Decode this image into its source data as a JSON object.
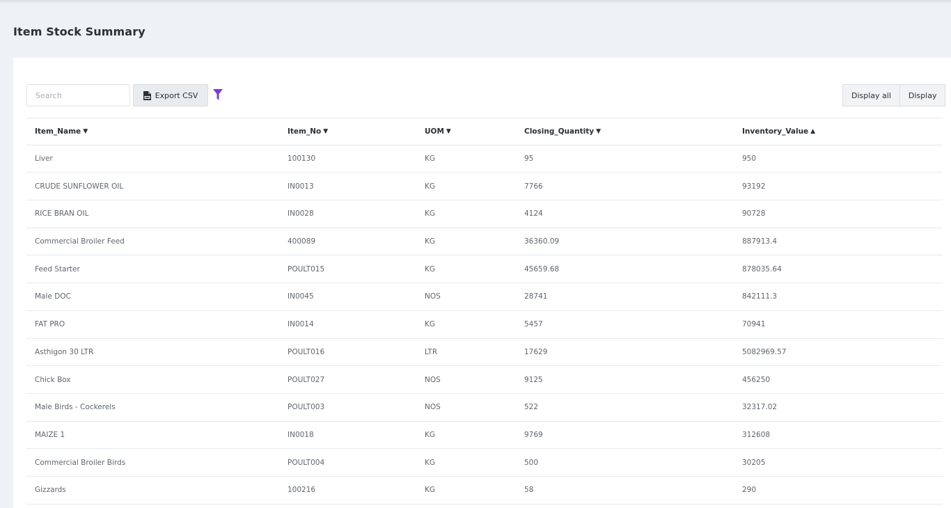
{
  "page": {
    "title": "Item Stock Summary"
  },
  "toolbar": {
    "search_placeholder": "Search",
    "export_label": "Export CSV",
    "display_all_label": "Display all",
    "display_label": "Display",
    "filter_icon": "filter-icon",
    "filter_color": "#7b3fd1"
  },
  "table": {
    "headers": [
      {
        "label": "Item_Name",
        "sort": "▼"
      },
      {
        "label": "Item_No",
        "sort": "▼"
      },
      {
        "label": "UOM",
        "sort": "▼"
      },
      {
        "label": "Closing_Quantity",
        "sort": "▼"
      },
      {
        "label": "Inventory_Value",
        "sort": "▲"
      }
    ],
    "rows": [
      [
        "Liver",
        "100130",
        "KG",
        "95",
        "950"
      ],
      [
        "CRUDE SUNFLOWER OIL",
        "IN0013",
        "KG",
        "7766",
        "93192"
      ],
      [
        "RICE BRAN OIL",
        "IN0028",
        "KG",
        "4124",
        "90728"
      ],
      [
        "Commercial Broiler Feed",
        "400089",
        "KG",
        "36360.09",
        "887913.4"
      ],
      [
        "Feed Starter",
        "POULT015",
        "KG",
        "45659.68",
        "878035.64"
      ],
      [
        "Male DOC",
        "IN0045",
        "NOS",
        "28741",
        "842111.3"
      ],
      [
        "FAT PRO",
        "IN0014",
        "KG",
        "5457",
        "70941"
      ],
      [
        "Asthigon 30 LTR",
        "POULT016",
        "LTR",
        "17629",
        "5082969.57"
      ],
      [
        "Chick Box",
        "POULT027",
        "NOS",
        "9125",
        "456250"
      ],
      [
        "Male Birds - Cockerels",
        "POULT003",
        "NOS",
        "522",
        "32317.02"
      ],
      [
        "MAIZE 1",
        "IN0018",
        "KG",
        "9769",
        "312608"
      ],
      [
        "Commercial Broiler Birds",
        "POULT004",
        "KG",
        "500",
        "30205"
      ],
      [
        "Gizzards",
        "100216",
        "KG",
        "58",
        "290"
      ]
    ]
  }
}
